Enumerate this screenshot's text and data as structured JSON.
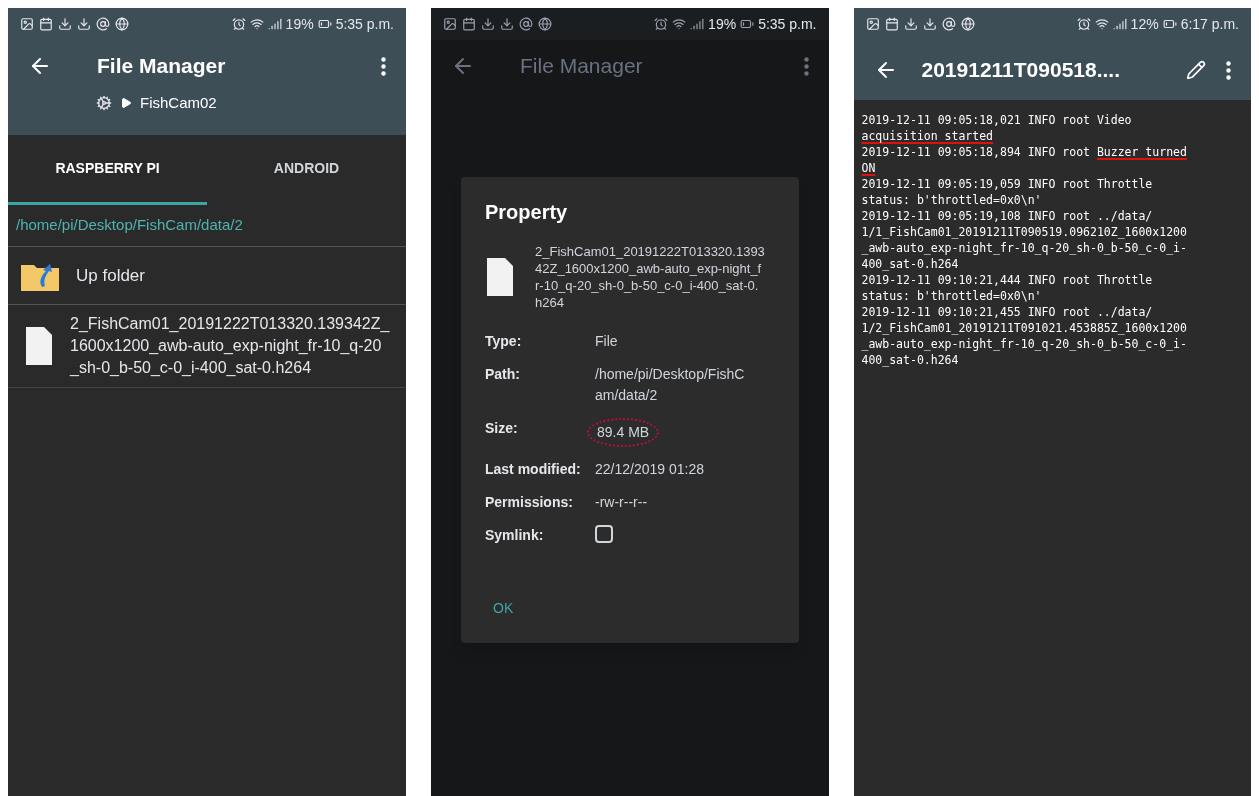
{
  "screens": [
    {
      "kind": "file_list",
      "status_bar": {
        "battery": "19%",
        "time": "5:35 p.m."
      },
      "toolbar": {
        "title": "File Manager",
        "breadcrumb": "FishCam02"
      },
      "tabs": [
        {
          "label": "RASPBERRY PI",
          "selected": true
        },
        {
          "label": "ANDROID",
          "selected": false
        }
      ],
      "path": "/home/pi/Desktop/FishCam/data/2",
      "items": [
        {
          "kind": "up",
          "name": "Up folder"
        },
        {
          "kind": "file",
          "name": "2_FishCam01_20191222T013320.139342Z_1600x1200_awb-auto_exp-night_fr-10_q-20_sh-0_b-50_c-0_i-400_sat-0.h264"
        }
      ]
    },
    {
      "kind": "property_dialog",
      "status_bar": {
        "battery": "19%",
        "time": "5:35 p.m."
      },
      "toolbar": {
        "title": "File Manager"
      },
      "dialog": {
        "title": "Property",
        "file_name": "2_FishCam01_20191222T013320.139342Z_1600x1200_awb-auto_exp-night_fr-10_q-20_sh-0_b-50_c-0_i-400_sat-0.h264",
        "fields": [
          {
            "kind": "text",
            "label": "Type:",
            "value": "File",
            "circled": false
          },
          {
            "kind": "text",
            "label": "Path:",
            "value": "/home/pi/Desktop/FishCam/data/2",
            "circled": false
          },
          {
            "kind": "text",
            "label": "Size:",
            "value": "89.4 MB",
            "circled": true
          },
          {
            "kind": "text",
            "label": "Last modified:",
            "value": "22/12/2019 01:28",
            "circled": false
          },
          {
            "kind": "text",
            "label": "Permissions:",
            "value": "-rw-r--r--",
            "circled": false
          },
          {
            "kind": "checkbox",
            "label": "Symlink:",
            "checked": false
          }
        ],
        "button": "OK"
      }
    },
    {
      "kind": "log_viewer",
      "status_bar": {
        "battery": "12%",
        "time": "6:17 p.m."
      },
      "toolbar": {
        "title": "20191211T090518...."
      },
      "log_lines": [
        [
          {
            "text": "2019-12-11 09:05:18,021 INFO root Video",
            "underlined": false
          }
        ],
        [
          {
            "text": "acquisition started",
            "underlined": true
          }
        ],
        [
          {
            "text": "2019-12-11 09:05:18,894 INFO root ",
            "underlined": false
          },
          {
            "text": "Buzzer turned",
            "underlined": true
          }
        ],
        [
          {
            "text": "ON",
            "underlined": true
          }
        ],
        [
          {
            "text": "2019-12-11 09:05:19,059 INFO root Throttle",
            "underlined": false
          }
        ],
        [
          {
            "text": "status: b'throttled=0x0\\n'",
            "underlined": false
          }
        ],
        [
          {
            "text": "2019-12-11 09:05:19,108 INFO root ../data/",
            "underlined": false
          }
        ],
        [
          {
            "text": "1/1_FishCam01_20191211T090519.096210Z_1600x1200",
            "underlined": false
          }
        ],
        [
          {
            "text": "_awb-auto_exp-night_fr-10_q-20_sh-0_b-50_c-0_i-",
            "underlined": false
          }
        ],
        [
          {
            "text": "400_sat-0.h264",
            "underlined": false
          }
        ],
        [
          {
            "text": "2019-12-11 09:10:21,444 INFO root Throttle",
            "underlined": false
          }
        ],
        [
          {
            "text": "status: b'throttled=0x0\\n'",
            "underlined": false
          }
        ],
        [
          {
            "text": "2019-12-11 09:10:21,455 INFO root ../data/",
            "underlined": false
          }
        ],
        [
          {
            "text": "1/2_FishCam01_20191211T091021.453885Z_1600x1200",
            "underlined": false
          }
        ],
        [
          {
            "text": "_awb-auto_exp-night_fr-10_q-20_sh-0_b-50_c-0_i-",
            "underlined": false
          }
        ],
        [
          {
            "text": "400_sat-0.h264",
            "underlined": false
          }
        ]
      ]
    }
  ]
}
